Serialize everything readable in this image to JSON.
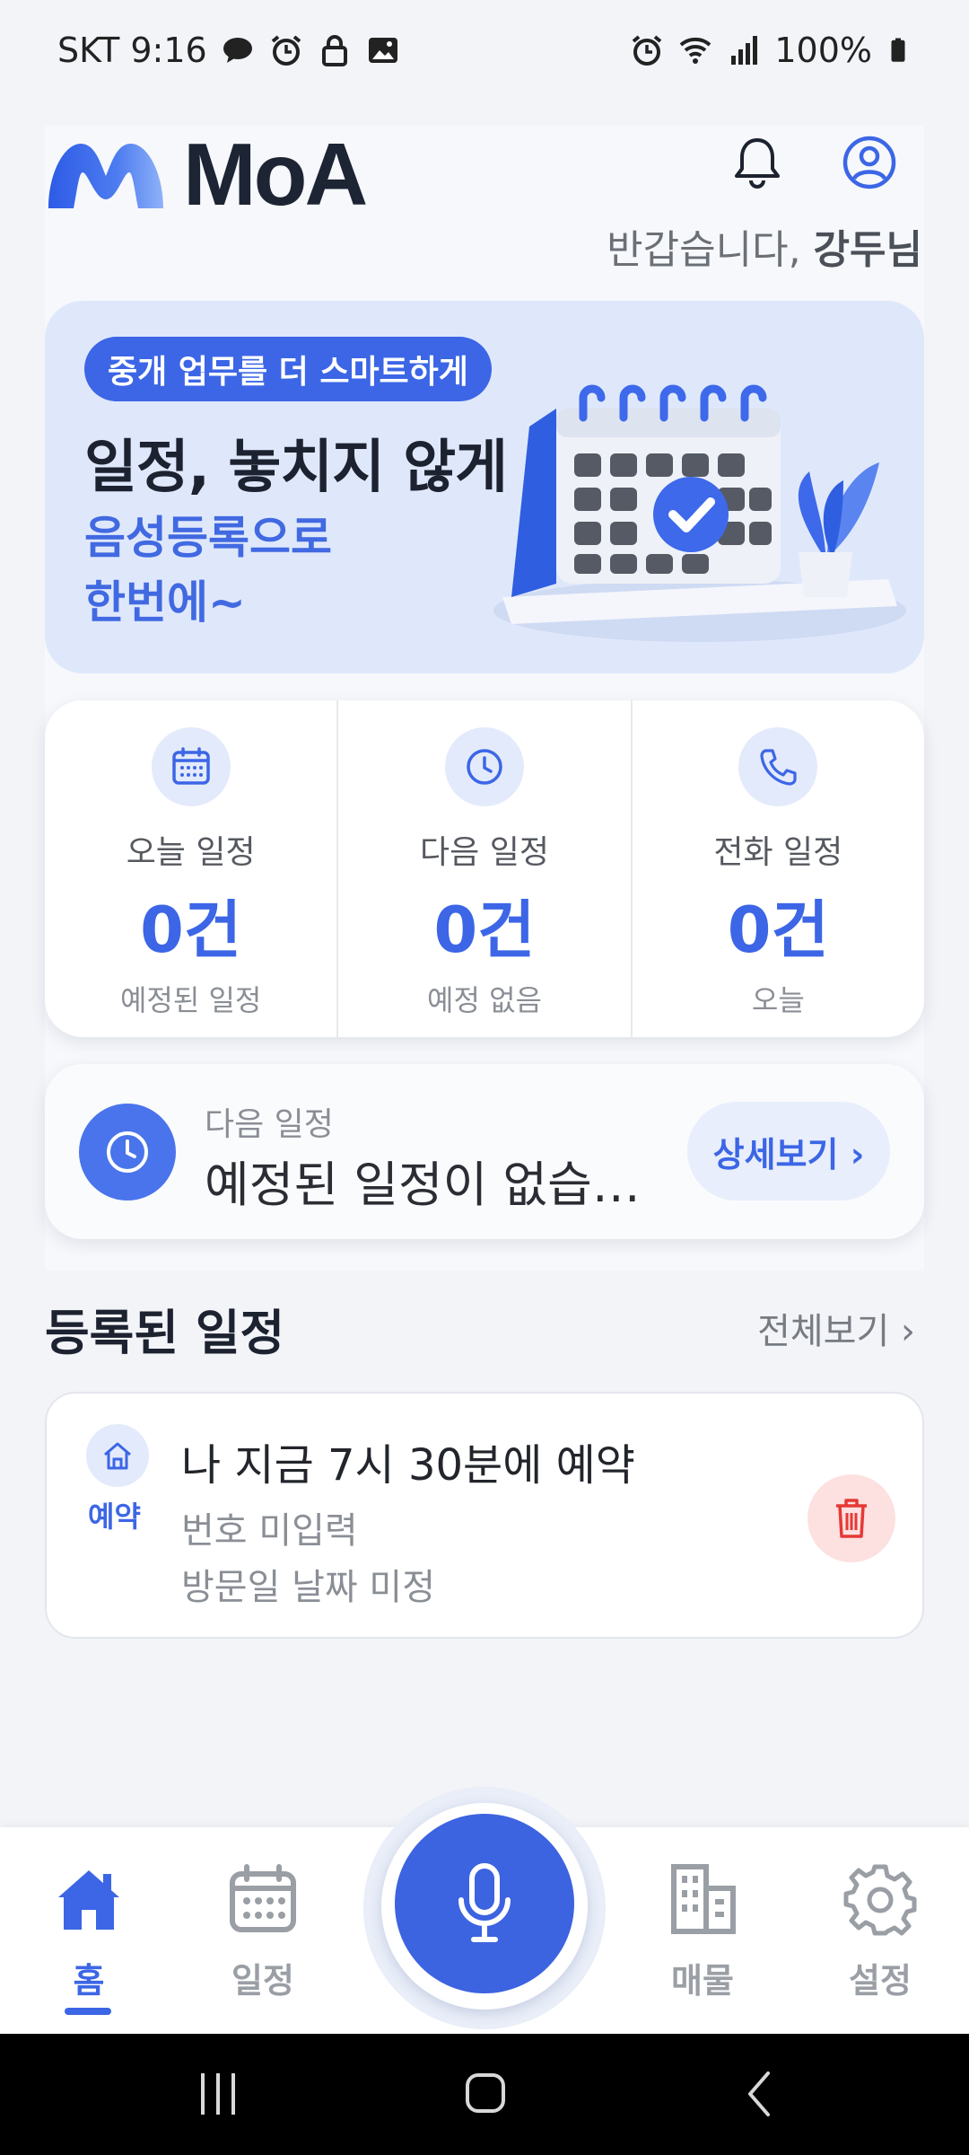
{
  "status_bar": {
    "carrier_time": "SKT 9:16",
    "battery": "100%"
  },
  "header": {
    "app_name": "MoA",
    "greeting_prefix": "반갑습니다, ",
    "user_name": "강두님"
  },
  "banner": {
    "pill": "중개 업무를 더 스마트하게",
    "title": "일정, 놓치지 않게",
    "sub_line1": "음성등록으로",
    "sub_line2": "한번에~"
  },
  "stats": [
    {
      "label": "오늘 일정",
      "value": "0건",
      "sub": "예정된 일정",
      "icon": "calendar-icon"
    },
    {
      "label": "다음 일정",
      "value": "0건",
      "sub": "예정 없음",
      "icon": "clock-icon"
    },
    {
      "label": "전화 일정",
      "value": "0건",
      "sub": "오늘",
      "icon": "phone-icon"
    }
  ],
  "next_schedule": {
    "label": "다음 일정",
    "value": "예정된 일정이 없습니다",
    "button": "상세보기 ›"
  },
  "registered": {
    "title": "등록된 일정",
    "view_all": "전체보기 ›",
    "items": [
      {
        "tag": "예약",
        "title": "나 지금 7시 30분에 예약",
        "line1": "번호 미입력",
        "line2": "방문일 날짜 미정"
      }
    ]
  },
  "bottom_nav": {
    "home": "홈",
    "schedule": "일정",
    "property": "매물",
    "settings": "설정"
  },
  "colors": {
    "accent": "#3c66e6",
    "danger": "#e53935",
    "banner_bg": "#dfe8fb"
  }
}
